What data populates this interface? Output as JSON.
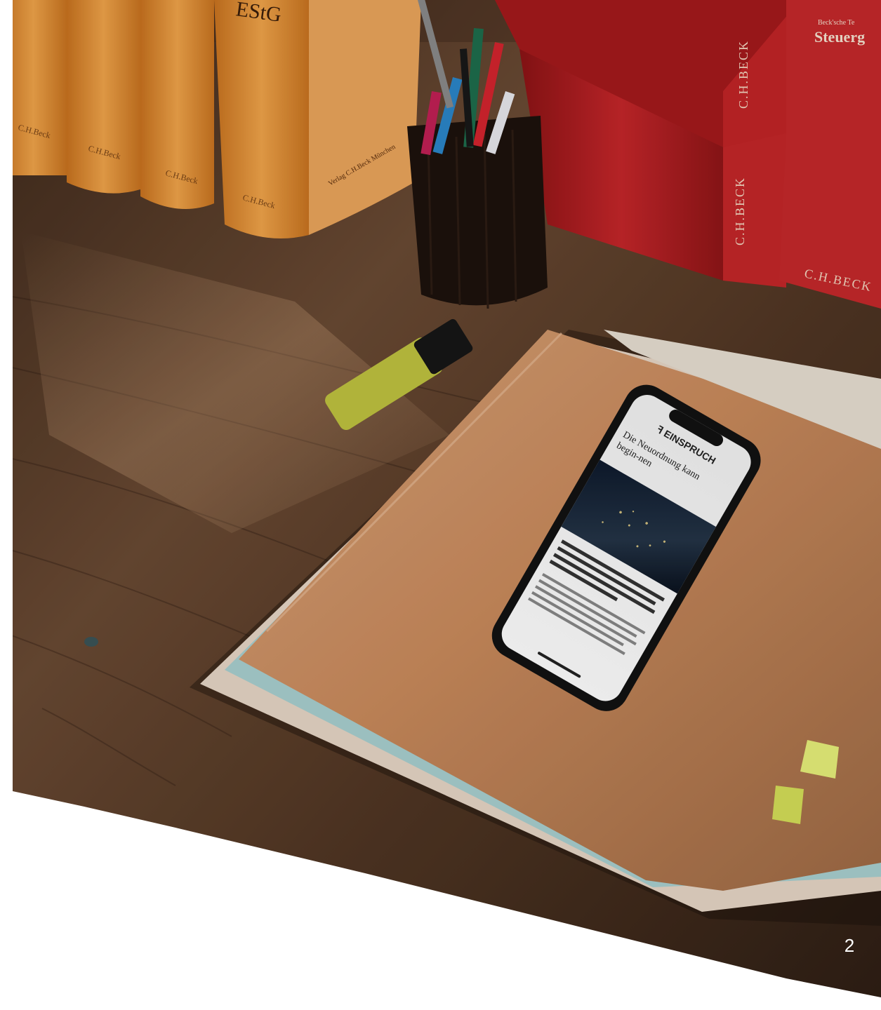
{
  "slide": {
    "page_number": "2"
  },
  "photo": {
    "books_left": {
      "spine_text": [
        "EStG",
        "C.H.Beck",
        "C.H.Beck",
        "C.H.Beck",
        "C.H.Beck",
        "Verlag C.H.Beck München"
      ]
    },
    "books_right": {
      "spine_text": [
        "C.H.BECK",
        "C.H.BECK",
        "C.H.BECK",
        "Steuerg",
        "Beck'sche Te"
      ]
    },
    "phone_screen": {
      "app_name": "EINSPRUCH",
      "headline": "Die Neuordnung kann begin-nen"
    }
  },
  "colors": {
    "desk": "#5a3c28",
    "folder": "#c98a5c",
    "red_books": "#b21d1f",
    "orange_books": "#e99b3a",
    "highlighter": "#c6c94a",
    "sticky_tabs": "#e8f07a"
  }
}
